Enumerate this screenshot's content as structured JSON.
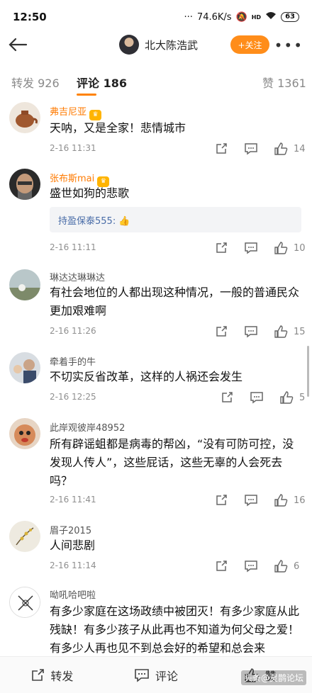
{
  "status": {
    "time": "12:50",
    "net": "74.6K/s",
    "hd": "HD",
    "battery": "63"
  },
  "header": {
    "name": "北大陈浩武",
    "follow_label": "+关注"
  },
  "tabs": [
    {
      "label": "转发",
      "count": "926"
    },
    {
      "label": "评论",
      "count": "186"
    },
    {
      "label": "赞",
      "count": "1361"
    }
  ],
  "comments": [
    {
      "name": "弗吉尼亚",
      "vip": true,
      "text": "天呐，又是全家！悲情城市",
      "time": "2-16 11:31",
      "likes": "14"
    },
    {
      "name": "张布斯mai",
      "vip": true,
      "text": "盛世如狗的悲歌",
      "reply": "持盈保泰555: 👍",
      "time": "2-16 11:11",
      "likes": "10"
    },
    {
      "name": "琳达达琳琳达",
      "vip": false,
      "text": "有社会地位的人都出现这种情况，一般的普通民众更加艰难啊",
      "time": "2-16 11:26",
      "likes": "15"
    },
    {
      "name": "牵着手的牛",
      "vip": false,
      "text": "不切实反省改革，这样的人祸还会发生",
      "time": "2-16 12:25",
      "likes": "5"
    },
    {
      "name": "此岸观彼岸48952",
      "vip": false,
      "text": "所有辟谣蛆都是病毒的帮凶，“没有可防可控，没发现人传人”，这些屁话，这些无辜的人会死去吗？",
      "time": "2-16 11:41",
      "likes": "16"
    },
    {
      "name": "眉子2015",
      "vip": false,
      "text": "人间悲剧",
      "time": "2-16 11:14",
      "likes": "6"
    },
    {
      "name": "呦吼哈吧啦",
      "vip": false,
      "text": "有多少家庭在这场政绩中被团灭！有多少家庭从此残缺！有多少孩子从此再也不知道为何父母之爱！有多少人再也见不到总会好的希望和总会来"
    }
  ],
  "bottom": {
    "repost": "转发",
    "comment": "评论",
    "like": "赞"
  },
  "watermark": "头条@灵鹊论坛"
}
